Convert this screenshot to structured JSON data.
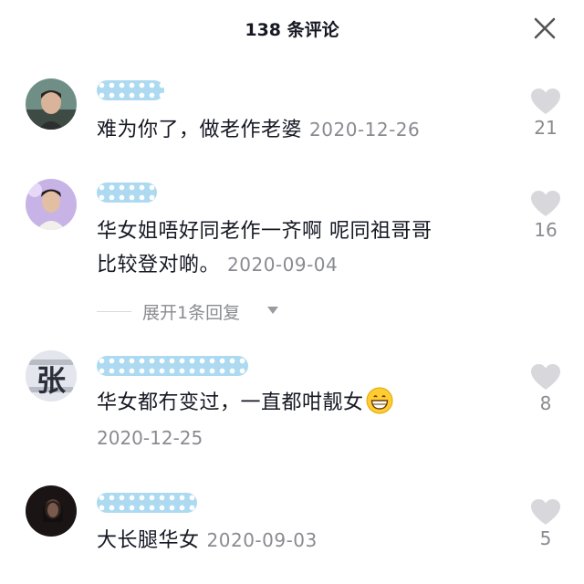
{
  "header": {
    "title": "138 条评论",
    "close_icon": "close-icon"
  },
  "comments": [
    {
      "username": "ríỳN3",
      "text": "难为你了，做老作老婆",
      "date": "2020-12-26",
      "likes": "21"
    },
    {
      "username": "",
      "text_line1": "华女姐唔好同老作一齐啊 呢同祖哥哥",
      "text_line2": "比较登对啲。",
      "date": "2020-09-04",
      "likes": "16",
      "expand_label": "展开1条回复"
    },
    {
      "username": "",
      "avatar_text": "张",
      "text": "华女都冇变过，一直都咁靓女",
      "emoji": "grinning-face-emoji",
      "date": "2020-12-25",
      "likes": "8"
    },
    {
      "username": "",
      "text": "大长腿华女",
      "date": "2020-09-03",
      "likes": "5"
    }
  ],
  "colors": {
    "text": "#161823",
    "muted": "#8a8b91",
    "heart": "#d8d8dc",
    "username_mask": "#9fd4ef"
  }
}
